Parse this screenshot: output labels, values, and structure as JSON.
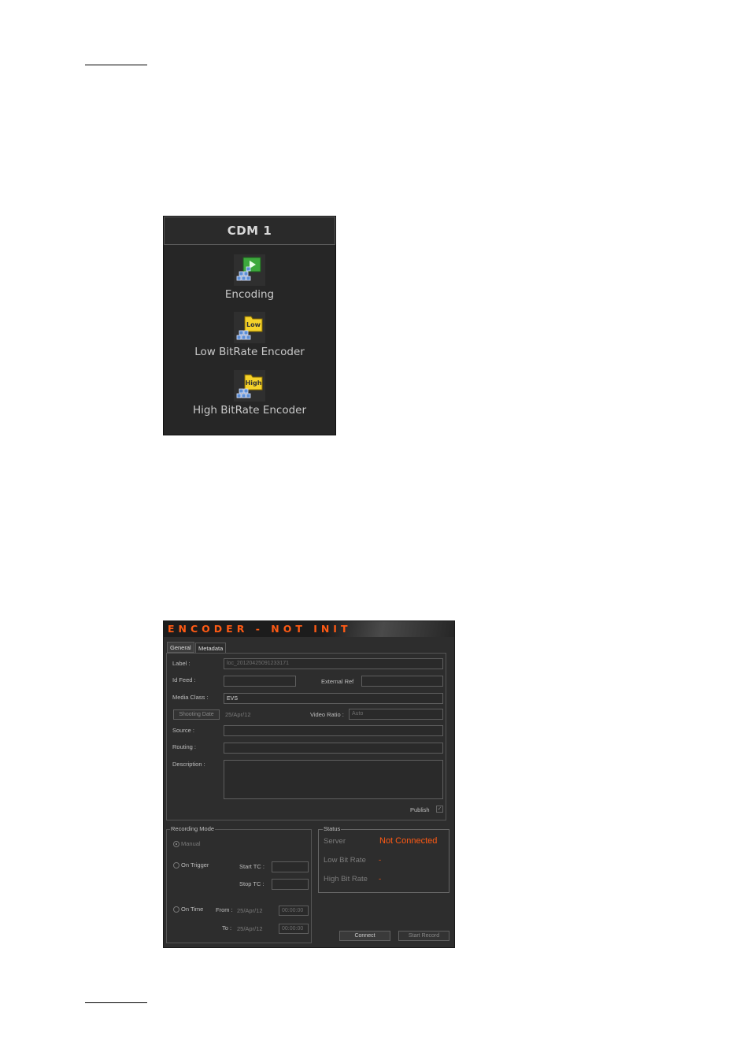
{
  "cdm_panel": {
    "title": "CDM 1",
    "items": [
      {
        "label": "Encoding",
        "icon": "encoding-icon",
        "badge": "▶"
      },
      {
        "label": "Low BitRate Encoder",
        "icon": "low-bitrate-icon",
        "badge": "Low"
      },
      {
        "label": "High BitRate Encoder",
        "icon": "high-bitrate-icon",
        "badge": "High"
      }
    ]
  },
  "encoder": {
    "title": "ENCODER - NOT INIT",
    "tabs": [
      "General",
      "Metadata"
    ],
    "general": {
      "label_caption": "Label :",
      "label_value": "loc_20120425091233171",
      "id_feed_caption": "Id Feed :",
      "external_ref_caption": "External Ref",
      "media_class_caption": "Media Class :",
      "media_class_value": "EVS",
      "shooting_date_button": "Shooting Date",
      "shooting_date_value": "25/Apr/12",
      "video_ratio_caption": "Video Ratio :",
      "video_ratio_value": "Auto",
      "source_caption": "Source :",
      "routing_caption": "Routing :",
      "description_caption": "Description :",
      "publish_caption": "Publish"
    },
    "recording_mode": {
      "legend": "Recording Mode",
      "manual": "Manual",
      "on_trigger": "On Trigger",
      "start_tc": "Start TC :",
      "stop_tc": "Stop TC :",
      "on_time": "On Time",
      "from": "From :",
      "to": "To :",
      "from_date": "25/Apr/12",
      "to_date": "25/Apr/12",
      "from_time": "00:00:00",
      "to_time": "00:00:00"
    },
    "status": {
      "legend": "Status",
      "server_caption": "Server",
      "server_value": "Not Connected",
      "low_caption": "Low Bit Rate",
      "low_value": "-",
      "high_caption": "High Bit Rate",
      "high_value": "-"
    },
    "buttons": {
      "connect": "Connect",
      "start_record": "Start Record"
    },
    "colors": {
      "accent": "#ff5a14",
      "panel": "#2d2d2d"
    }
  }
}
